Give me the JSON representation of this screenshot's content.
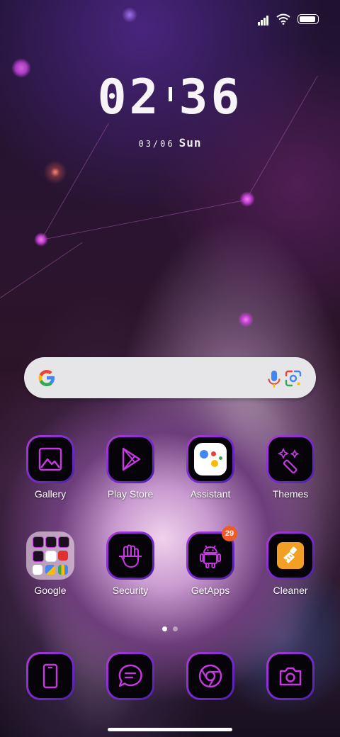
{
  "status_bar": {
    "signal_icon": "signal-icon",
    "wifi_icon": "wifi-icon",
    "battery_icon": "battery-icon"
  },
  "clock": {
    "hours": "02",
    "minutes": "36"
  },
  "date": {
    "day": "03/06",
    "weekday": "Sun"
  },
  "search": {
    "google_icon": "google-g-icon",
    "mic_icon": "mic-icon",
    "lens_icon": "google-lens-icon"
  },
  "apps_row1": [
    {
      "label": "Gallery",
      "icon": "gallery-icon"
    },
    {
      "label": "Play Store",
      "icon": "play-store-icon"
    },
    {
      "label": "Assistant",
      "icon": "assistant-icon"
    },
    {
      "label": "Themes",
      "icon": "themes-icon"
    }
  ],
  "apps_row2": [
    {
      "label": "Google",
      "icon": "folder-icon"
    },
    {
      "label": "Security",
      "icon": "security-icon"
    },
    {
      "label": "GetApps",
      "icon": "getapps-icon",
      "badge": "29"
    },
    {
      "label": "Cleaner",
      "icon": "cleaner-icon"
    }
  ],
  "page_indicator": {
    "pages": 2,
    "current": 1
  },
  "dock": [
    {
      "icon": "phone-icon"
    },
    {
      "icon": "messages-icon"
    },
    {
      "icon": "chrome-icon"
    },
    {
      "icon": "camera-icon"
    }
  ],
  "colors": {
    "accent": "#9b30d9",
    "neon_pink": "#c638e0",
    "badge": "#f05a28"
  }
}
